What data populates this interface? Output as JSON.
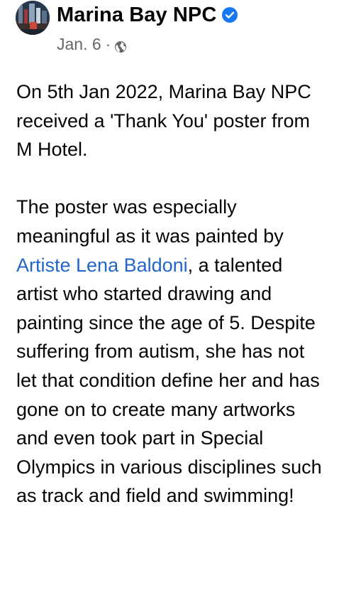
{
  "post": {
    "page_name": "Marina Bay NPC",
    "verified": true,
    "verified_badge_icon": "verified-badge-icon",
    "date": "Jan. 6",
    "separator": "·",
    "audience_icon": "globe-icon",
    "paragraph_1": "On 5th Jan 2022, Marina Bay NPC received a 'Thank You' poster from M Hotel.",
    "paragraph_2_lead": "The poster was especially meaningful as it was painted by ",
    "mention": "Artiste Lena Baldoni",
    "paragraph_2_rest": ", a talented artist who started drawing and painting since the age of 5. Despite suffering from autism, she has not let that condition define her and has gone on to create many artworks and even took part in Special Olympics in various disciplines such as track and field and swimming!",
    "colors": {
      "text": "#050505",
      "meta": "#65676b",
      "mention": "#2166c8",
      "verified": "#1877f2"
    }
  }
}
